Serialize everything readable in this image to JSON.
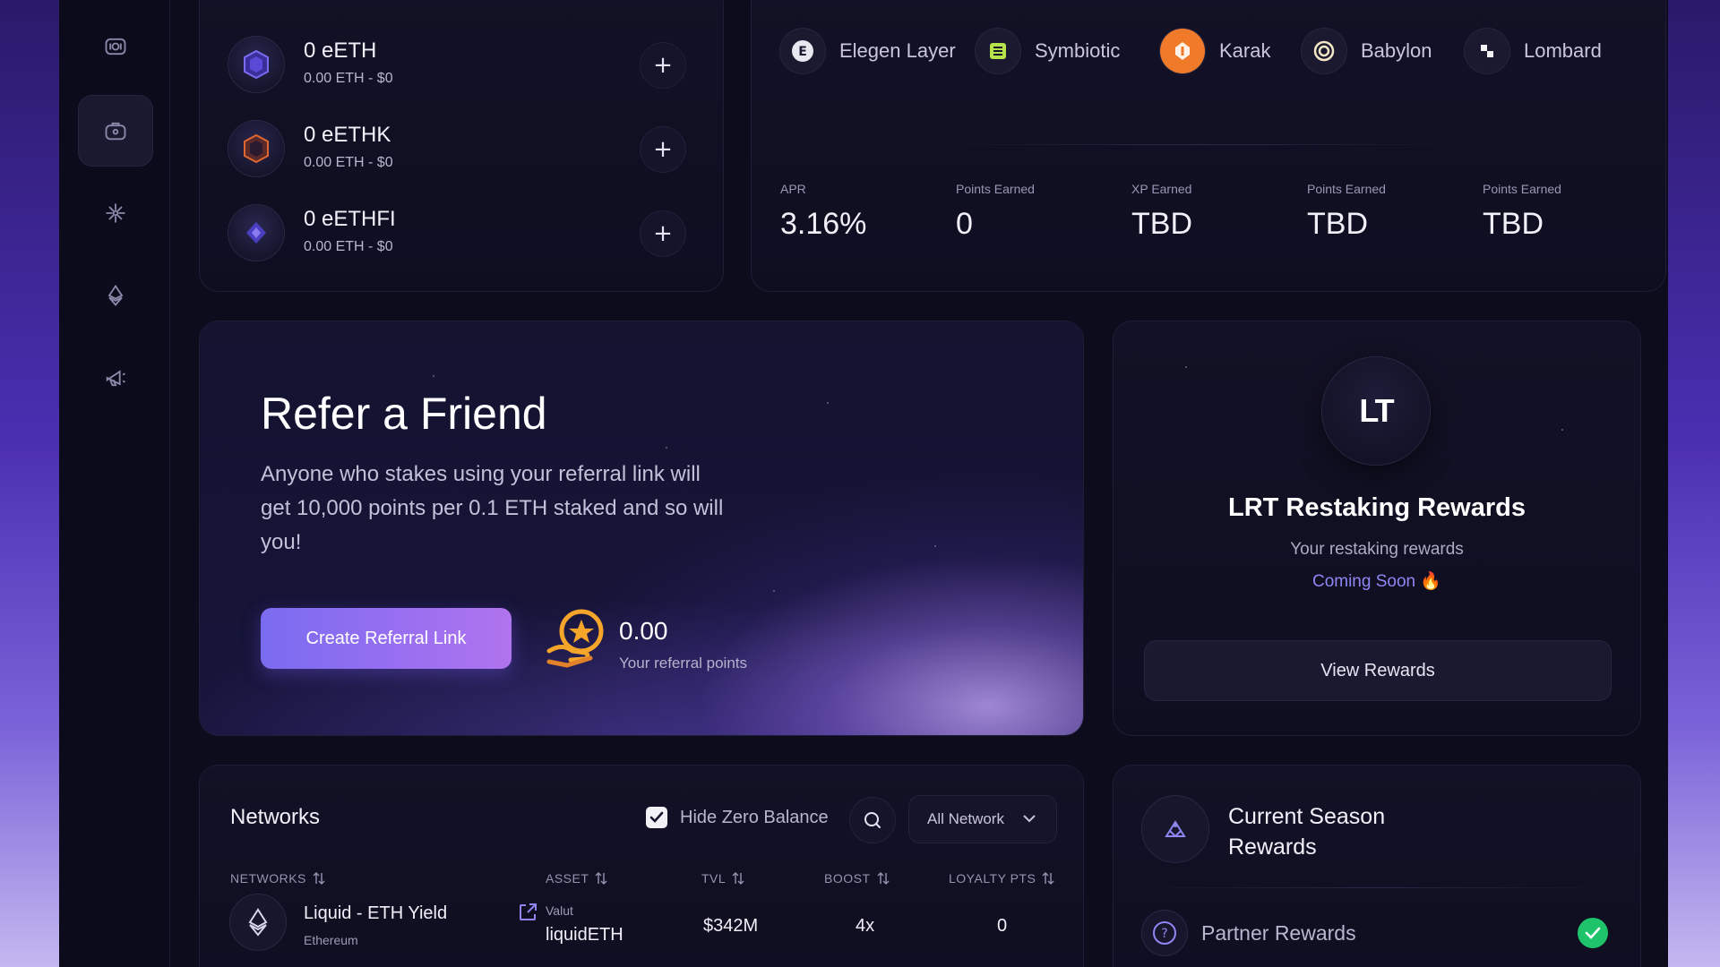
{
  "tokens": [
    {
      "name": "0 eETH",
      "sub": "0.00 ETH - $0"
    },
    {
      "name": "0 eETHK",
      "sub": "0.00 ETH - $0"
    },
    {
      "name": "0 eETHFI",
      "sub": "0.00 ETH - $0"
    }
  ],
  "add_label": "+",
  "partners": [
    {
      "label": "Elegen Layer",
      "icon": "elegen-layer-icon"
    },
    {
      "label": "Symbiotic",
      "icon": "symbiotic-icon"
    },
    {
      "label": "Karak",
      "icon": "karak-icon"
    },
    {
      "label": "Babylon",
      "icon": "babylon-icon"
    },
    {
      "label": "Lombard",
      "icon": "lombard-icon"
    }
  ],
  "stats": [
    {
      "label": "APR",
      "value": "3.16%"
    },
    {
      "label": "Points Earned",
      "value": "0"
    },
    {
      "label": "XP Earned",
      "value": "TBD"
    },
    {
      "label": "Points Earned",
      "value": "TBD"
    },
    {
      "label": "Points Earned",
      "value": "TBD"
    }
  ],
  "referral": {
    "title": "Refer a Friend",
    "description": "Anyone who stakes using your referral link will get 10,000 points per 0.1 ETH staked and so will you!",
    "button": "Create Referral Link",
    "points_value": "0.00",
    "points_label": "Your referral points"
  },
  "lrt": {
    "logo_text": "LT",
    "title": "LRT Restaking Rewards",
    "subtitle": "Your restaking rewards",
    "coming_soon": "Coming Soon 🔥",
    "button": "View Rewards"
  },
  "networks": {
    "title": "Networks",
    "hide_zero_label": "Hide Zero Balance",
    "hide_zero_checked": true,
    "filter_value": "All Network",
    "columns": [
      "NETWORKS",
      "ASSET",
      "TVL",
      "BOOST",
      "LOYALTY PTS"
    ],
    "rows": [
      {
        "name": "Liquid - ETH Yield",
        "chain": "Ethereum",
        "asset_label": "Valut",
        "asset": "liquidETH",
        "tvl": "$342M",
        "boost": "4x",
        "loyalty": "0"
      }
    ]
  },
  "season": {
    "title": "Current Season Rewards",
    "partner_rewards": "Partner Rewards",
    "partner_rewards_done": true
  },
  "colors": {
    "accent": "#8e86f3",
    "success": "#1fc36a",
    "karak": "#f07a2a"
  }
}
